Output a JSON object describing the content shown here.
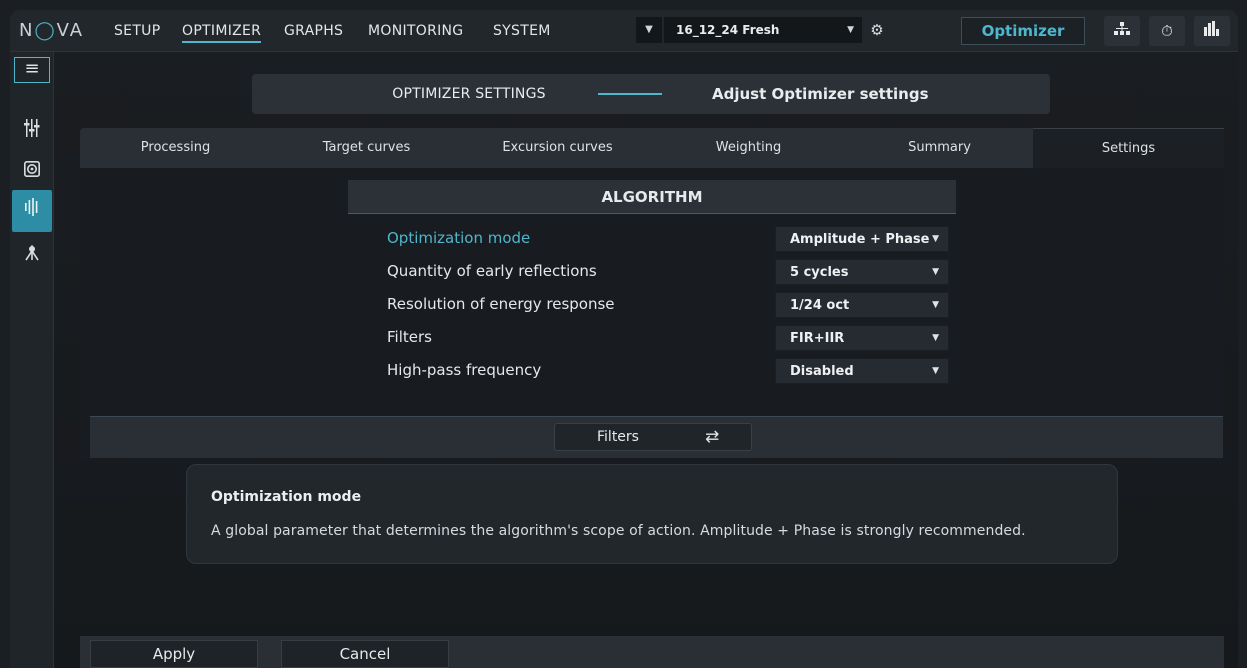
{
  "app": {
    "logo": "NOVA",
    "nav": [
      "SETUP",
      "OPTIMIZER",
      "GRAPHS",
      "MONITORING",
      "SYSTEM"
    ],
    "active_nav": "OPTIMIZER",
    "preset": "16_12_24 Fresh",
    "module_button": "Optimizer",
    "toolbar_icons": [
      "network-icon",
      "stopwatch-icon",
      "bar-chart-icon"
    ],
    "accent": "#4fb6cc"
  },
  "sidebar": {
    "menu_icon": "hamburger-icon",
    "icons": [
      "mixer-icon",
      "speaker-icon",
      "waveform-icon",
      "tripod-icon"
    ],
    "active_index": 2
  },
  "header": {
    "title": "OPTIMIZER SETTINGS",
    "subtitle": "Adjust Optimizer settings"
  },
  "tabs": [
    "Processing",
    "Target curves",
    "Excursion curves",
    "Weighting",
    "Summary",
    "Settings"
  ],
  "active_tab": "Settings",
  "algorithm": {
    "title": "ALGORITHM",
    "params": [
      {
        "label": "Optimization mode",
        "value": "Amplitude + Phase"
      },
      {
        "label": "Quantity of early reflections",
        "value": "5 cycles"
      },
      {
        "label": "Resolution of energy response",
        "value": "1/24 oct"
      },
      {
        "label": "Filters",
        "value": "FIR+IIR"
      },
      {
        "label": "High-pass frequency",
        "value": "Disabled"
      }
    ]
  },
  "filters_button": "Filters",
  "info": {
    "title": "Optimization mode",
    "text": "A global parameter that determines the algorithm's scope of action. Amplitude + Phase is strongly recommended."
  },
  "buttons": {
    "apply": "Apply",
    "cancel": "Cancel"
  }
}
